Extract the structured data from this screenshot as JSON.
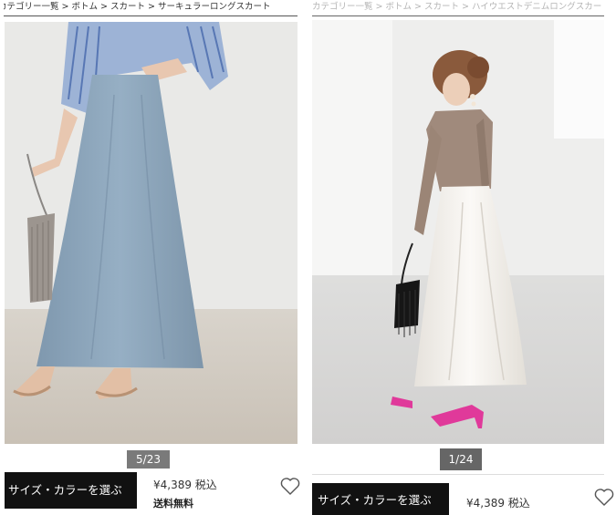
{
  "left_product": {
    "breadcrumb": [
      "カテゴリー一覧",
      "ボトム",
      "スカート",
      "サーキュラーロングスカート"
    ],
    "breadcrumb_separator": ">",
    "image_counter": "5/23",
    "select_button_label": "サイズ・カラーを選ぶ",
    "price": "¥4,389 税込",
    "shipping": "送料無料",
    "favorite_icon": "heart-icon"
  },
  "right_product": {
    "breadcrumb": [
      "カテゴリー一覧",
      "ボトム",
      "スカート",
      "ハイウエストデニムロングスカート"
    ],
    "breadcrumb_separator": ">",
    "image_counter": "1/24",
    "select_button_label": "サイズ・カラーを選ぶ",
    "price": "¥4,389 税込",
    "favorite_icon": "heart-icon"
  },
  "colors": {
    "button_bg": "#111111",
    "counter_bg": "#6e6e6e",
    "skirt_left": "#8fa8be",
    "skirt_right": "#f6f3ee",
    "heels_right": "#e0399a"
  }
}
